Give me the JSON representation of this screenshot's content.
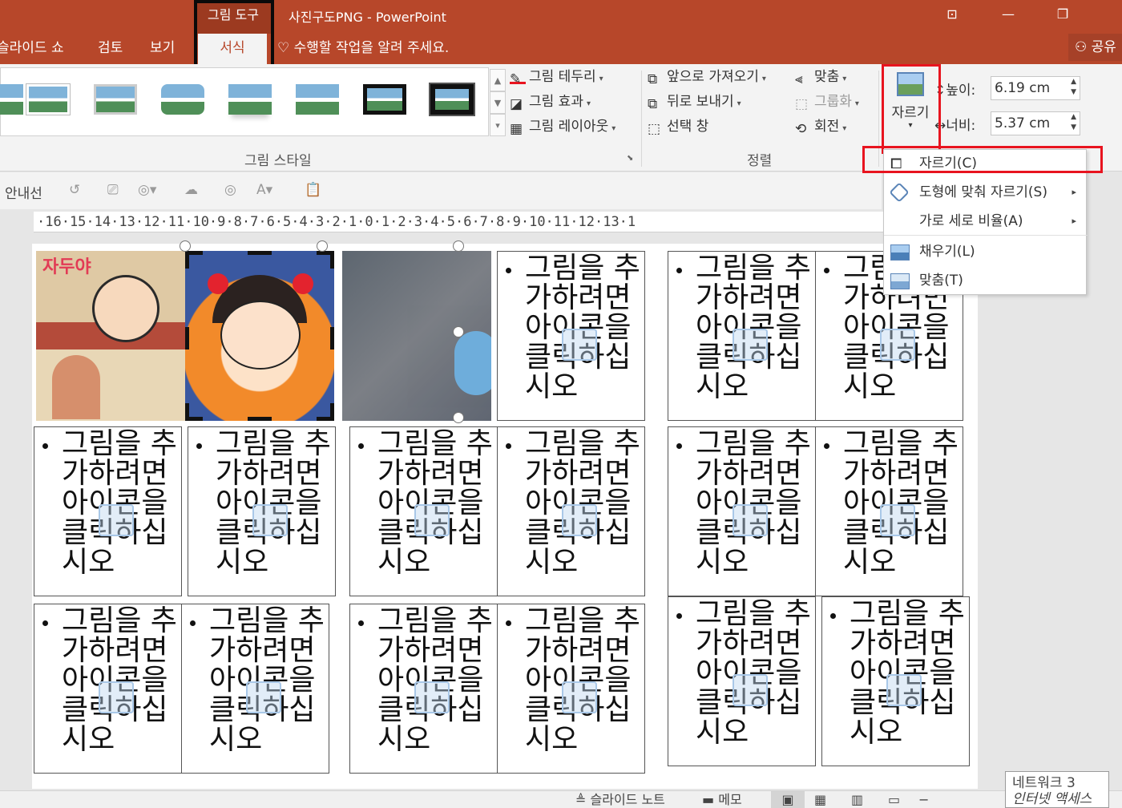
{
  "titlebar": {
    "context_group": "그림 도구",
    "doc_title": "사진구도PNG - PowerPoint",
    "tabs": [
      "슬라이드 쇼",
      "검토",
      "보기"
    ],
    "active_tab": "서식",
    "tell_me": "수행할 작업을 알려 주세요.",
    "share": "공유"
  },
  "ribbon": {
    "picture_styles_label": "그림 스타일",
    "arrange_label": "정렬",
    "commands": {
      "border": "그림 테두리",
      "effects": "그림 효과",
      "layout": "그림 레이아웃",
      "bring_forward": "앞으로 가져오기",
      "send_backward": "뒤로 보내기",
      "selection_pane": "선택 창",
      "align": "맞춤",
      "group": "그룹화",
      "rotate": "회전",
      "crop": "자르기"
    },
    "size": {
      "height_label": "높이:",
      "height_value": "6.19 cm",
      "width_label": "너비:",
      "width_value": "5.37 cm"
    }
  },
  "qat": {
    "guides_label": "안내선"
  },
  "ruler": {
    "text": "·16·15·14·13·12·11·10·9·8·7·6·5·4·3·2·1·0·1·2·3·4·5·6·7·8·9·10·11·12·13·1"
  },
  "placeholder_text": "그림을 추가하려면 아이콘을 클릭하십시오",
  "crop_menu": {
    "items": [
      {
        "label": "자르기(C)",
        "icon": "crop-icon"
      },
      {
        "label": "도형에 맞춰 자르기(S)",
        "icon": "shape-crop-icon",
        "submenu": true
      },
      {
        "label": "가로 세로 비율(A)",
        "icon": "",
        "submenu": true
      },
      {
        "label": "채우기(L)",
        "icon": "fill-icon"
      },
      {
        "label": "맞춤(T)",
        "icon": "fit-icon"
      }
    ]
  },
  "statusbar": {
    "notes": "슬라이드 노트",
    "comments": "메모",
    "tooltip_line1": "네트워크 3",
    "tooltip_line2": "인터넷 액세스"
  },
  "colors": {
    "accent": "#b7472a",
    "highlight_frame": "#e8141f"
  }
}
